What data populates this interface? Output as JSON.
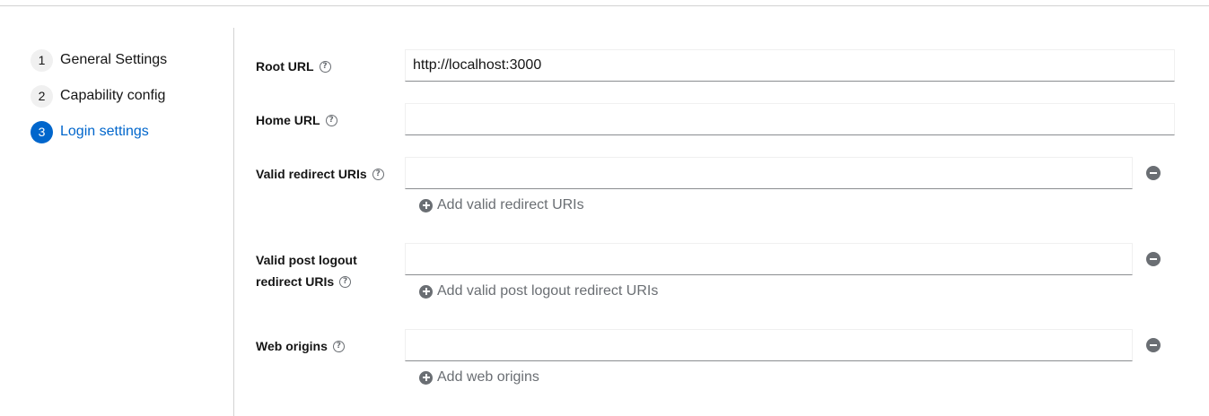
{
  "wizard": {
    "steps": [
      {
        "number": "1",
        "label": "General Settings"
      },
      {
        "number": "2",
        "label": "Capability config"
      },
      {
        "number": "3",
        "label": "Login settings"
      }
    ],
    "current_step": 3
  },
  "form": {
    "root_url": {
      "label": "Root URL",
      "value": "http://localhost:3000"
    },
    "home_url": {
      "label": "Home URL",
      "value": ""
    },
    "valid_redirect_uris": {
      "label": "Valid redirect URIs",
      "value": "",
      "add_label": "Add valid redirect URIs"
    },
    "valid_post_logout_redirect_uris": {
      "label_line1": "Valid post logout",
      "label_line2": "redirect URIs",
      "value": "",
      "add_label": "Add valid post logout redirect URIs"
    },
    "web_origins": {
      "label": "Web origins",
      "value": "",
      "add_label": "Add web origins"
    }
  },
  "icons": {
    "help": "question-circle-icon",
    "remove": "minus-circle-icon",
    "add": "plus-circle-icon"
  },
  "colors": {
    "accent": "#0066cc",
    "icon_gray": "#6a6e73",
    "step_bg": "#f0f0f0"
  }
}
